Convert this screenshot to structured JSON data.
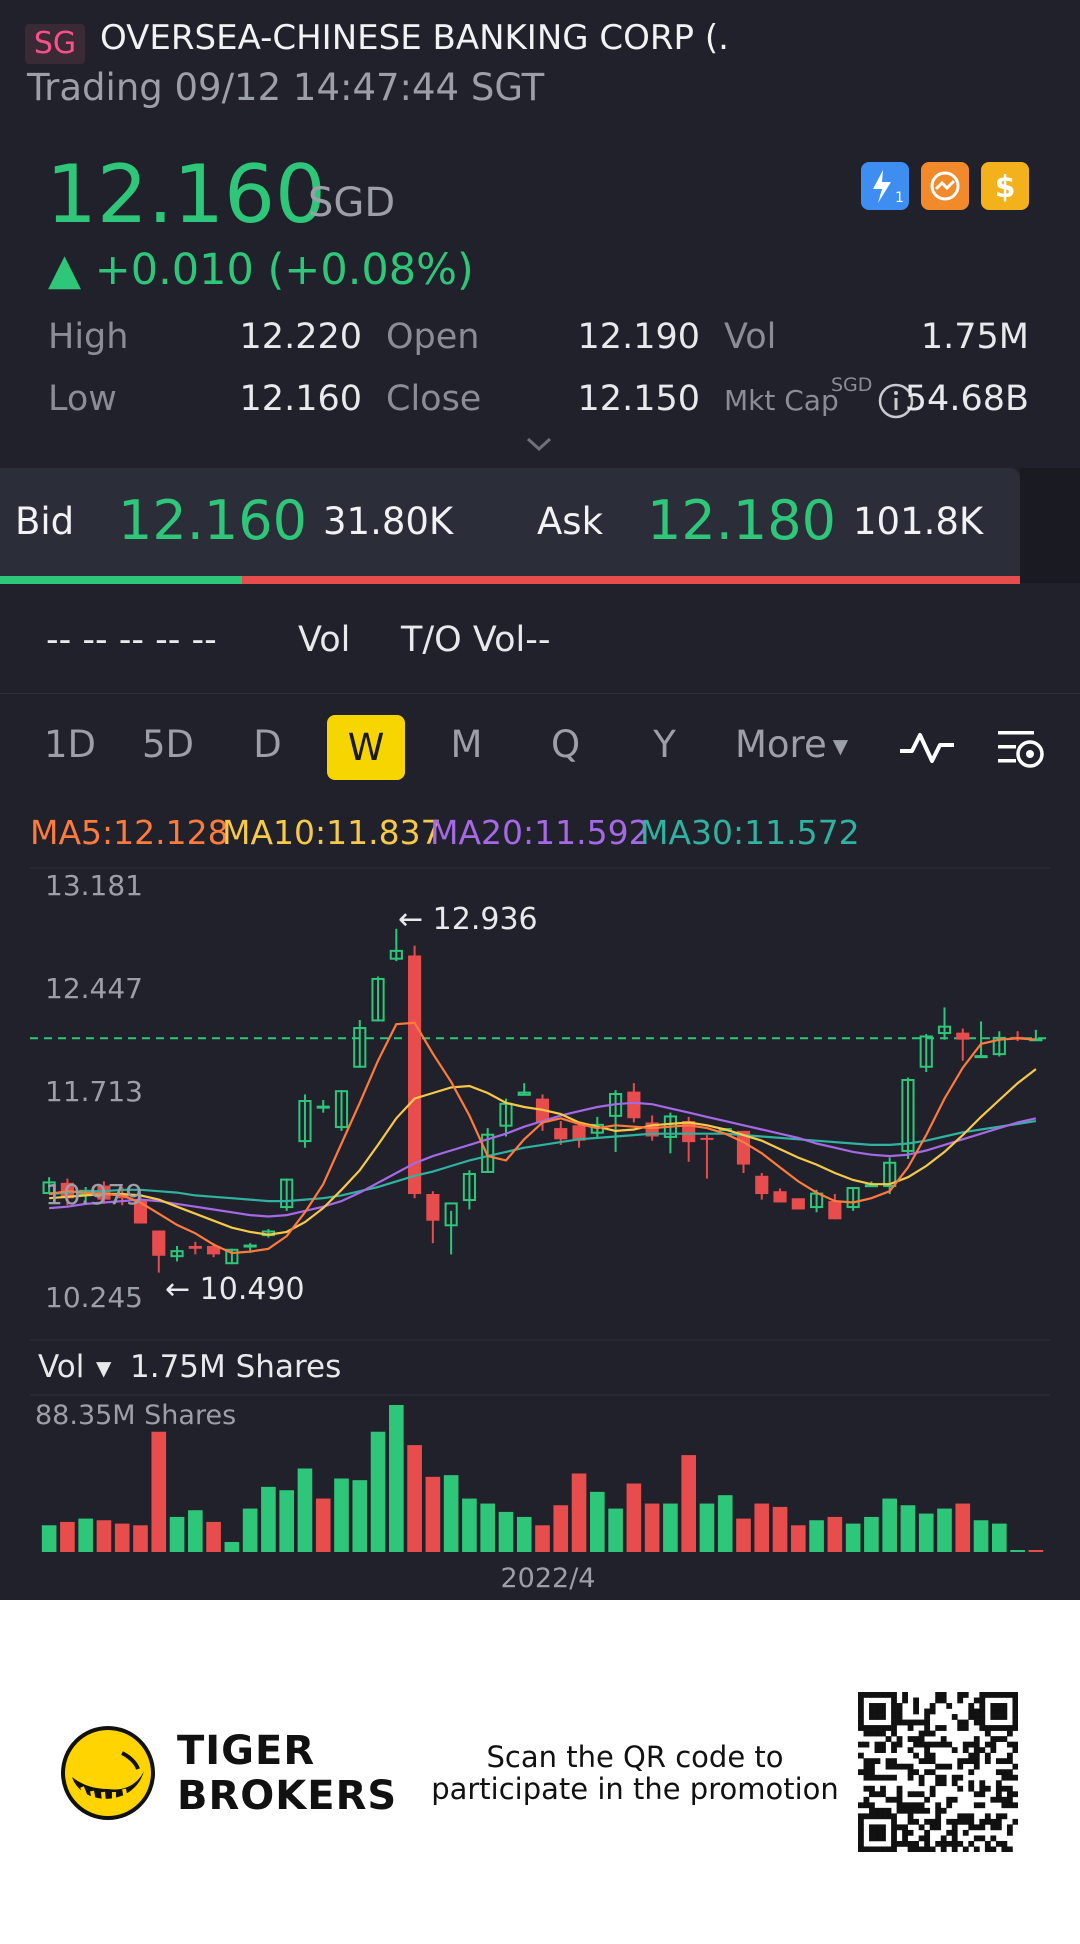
{
  "header": {
    "badge": "SG",
    "title": "OVERSEA-CHINESE BANKING CORP (.",
    "subtitle": "Trading 09/12 14:47:44 SGT"
  },
  "quote": {
    "price": "12.160",
    "currency": "SGD",
    "change": "▲ +0.010 (+0.08%)",
    "stats": {
      "high_label": "High",
      "high": "12.220",
      "open_label": "Open",
      "open": "12.190",
      "vol_label": "Vol",
      "vol": "1.75M",
      "low_label": "Low",
      "low": "12.160",
      "close_label": "Close",
      "close": "12.150",
      "mktcap_label": "Mkt Cap",
      "mktcap_sup": "SGD",
      "mktcap": "54.68B"
    },
    "icons": [
      "lightning-level1-icon",
      "transfer-icon",
      "dollar-icon"
    ]
  },
  "bidask": {
    "bid_label": "Bid",
    "bid_price": "12.160",
    "bid_size": "31.80K",
    "ask_label": "Ask",
    "ask_price": "12.180",
    "ask_size": "101.8K",
    "bid_ratio": 0.237
  },
  "turnover": {
    "dashes": "-- -- -- -- --",
    "vol_label": "Vol",
    "to_vol": "T/O Vol--"
  },
  "tabs": {
    "items": [
      "1D",
      "5D",
      "D",
      "W",
      "M",
      "Q",
      "Y"
    ],
    "active": "W",
    "more": "More"
  },
  "ma": {
    "ma5": "MA5:12.128",
    "ma10": "MA10:11.837",
    "ma20": "MA20:11.592",
    "ma30": "MA30:11.572"
  },
  "colors": {
    "up": "#2ec77a",
    "down": "#e84d4d",
    "ma5": "#ff7a3d",
    "ma10": "#f7c948",
    "ma20": "#a569e6",
    "ma30": "#2fb3a0",
    "accent": "#f7d500"
  },
  "chart_data": {
    "type": "candlestick",
    "y_ticks": [
      "13.181",
      "12.447",
      "11.713",
      "10.979",
      "10.245"
    ],
    "ylim": [
      10.245,
      13.181
    ],
    "high_annotation": "← 12.936",
    "low_annotation": "← 10.490",
    "last_price_line": 12.16,
    "ohlc": [
      [
        11.05,
        11.17,
        11.05,
        11.14
      ],
      [
        11.13,
        11.16,
        10.97,
        11.02
      ],
      [
        11.04,
        11.1,
        10.99,
        11.08
      ],
      [
        11.11,
        11.14,
        10.98,
        11.01
      ],
      [
        11.05,
        11.1,
        10.97,
        11.02
      ],
      [
        11.0,
        11.03,
        10.84,
        10.84
      ],
      [
        10.79,
        10.79,
        10.49,
        10.61
      ],
      [
        10.6,
        10.68,
        10.57,
        10.65
      ],
      [
        10.68,
        10.71,
        10.62,
        10.66
      ],
      [
        10.68,
        10.7,
        10.6,
        10.62
      ],
      [
        10.55,
        10.66,
        10.55,
        10.66
      ],
      [
        10.67,
        10.7,
        10.63,
        10.69
      ],
      [
        10.75,
        10.8,
        10.74,
        10.79
      ],
      [
        10.95,
        11.16,
        10.93,
        11.16
      ],
      [
        11.42,
        11.76,
        11.38,
        11.72
      ],
      [
        11.68,
        11.72,
        11.63,
        11.68
      ],
      [
        11.52,
        11.79,
        11.5,
        11.79
      ],
      [
        11.95,
        12.29,
        11.95,
        12.24
      ],
      [
        12.28,
        12.6,
        12.28,
        12.59
      ],
      [
        12.72,
        12.94,
        12.71,
        12.79
      ],
      [
        12.75,
        12.82,
        11.02,
        11.05
      ],
      [
        11.05,
        11.07,
        10.7,
        10.86
      ],
      [
        10.82,
        10.93,
        10.62,
        10.99
      ],
      [
        11.0,
        11.22,
        10.94,
        11.2
      ],
      [
        11.2,
        11.52,
        11.2,
        11.48
      ],
      [
        11.53,
        11.73,
        11.46,
        11.7
      ],
      [
        11.75,
        11.84,
        11.76,
        11.78
      ],
      [
        11.73,
        11.76,
        11.5,
        11.56
      ],
      [
        11.52,
        11.57,
        11.4,
        11.44
      ],
      [
        11.54,
        11.56,
        11.38,
        11.43
      ],
      [
        11.48,
        11.6,
        11.45,
        11.55
      ],
      [
        11.6,
        11.79,
        11.35,
        11.77
      ],
      [
        11.78,
        11.84,
        11.56,
        11.59
      ],
      [
        11.56,
        11.61,
        11.43,
        11.46
      ],
      [
        11.45,
        11.63,
        11.34,
        11.61
      ],
      [
        11.57,
        11.6,
        11.28,
        11.42
      ],
      [
        11.45,
        11.47,
        11.16,
        11.44
      ],
      [
        11.5,
        11.52,
        11.52,
        11.52
      ],
      [
        11.5,
        11.5,
        11.2,
        11.26
      ],
      [
        11.18,
        11.2,
        11.01,
        11.05
      ],
      [
        11.07,
        11.09,
        10.99,
        10.99
      ],
      [
        11.02,
        11.02,
        10.94,
        10.94
      ],
      [
        10.95,
        11.08,
        10.92,
        11.06
      ],
      [
        11.0,
        11.05,
        10.87,
        10.87
      ],
      [
        10.95,
        11.1,
        10.93,
        11.1
      ],
      [
        11.1,
        11.14,
        11.1,
        11.12
      ],
      [
        11.1,
        11.31,
        11.05,
        11.28
      ],
      [
        11.35,
        11.88,
        11.3,
        11.87
      ],
      [
        11.95,
        12.19,
        11.92,
        12.18
      ],
      [
        12.19,
        12.38,
        12.15,
        12.25
      ],
      [
        12.2,
        12.23,
        12.0,
        12.15
      ],
      [
        12.03,
        12.28,
        12.02,
        12.04
      ],
      [
        12.04,
        12.21,
        12.03,
        12.17
      ],
      [
        12.17,
        12.21,
        12.14,
        12.16
      ],
      [
        12.16,
        12.22,
        12.15,
        12.16
      ]
    ],
    "ma5": [
      11.05,
      11.07,
      11.06,
      11.05,
      11.04,
      10.99,
      10.91,
      10.83,
      10.77,
      10.69,
      10.63,
      10.64,
      10.66,
      10.75,
      10.92,
      11.12,
      11.41,
      11.7,
      12.0,
      12.26,
      12.27,
      12.05,
      11.85,
      11.61,
      11.32,
      11.29,
      11.44,
      11.56,
      11.59,
      11.55,
      11.52,
      11.54,
      11.53,
      11.52,
      11.53,
      11.54,
      11.52,
      11.48,
      11.42,
      11.34,
      11.24,
      11.14,
      11.06,
      11.0,
      10.99,
      11.02,
      11.07,
      11.24,
      11.47,
      11.73,
      11.95,
      12.12,
      12.15,
      12.16,
      12.15
    ],
    "ma10": [
      11.02,
      11.03,
      11.04,
      11.05,
      11.05,
      11.04,
      11.01,
      10.96,
      10.91,
      10.86,
      10.81,
      10.78,
      10.76,
      10.78,
      10.85,
      10.95,
      11.08,
      11.22,
      11.4,
      11.59,
      11.73,
      11.77,
      11.81,
      11.82,
      11.77,
      11.7,
      11.67,
      11.65,
      11.62,
      11.56,
      11.53,
      11.5,
      11.51,
      11.54,
      11.55,
      11.56,
      11.54,
      11.51,
      11.47,
      11.43,
      11.37,
      11.31,
      11.26,
      11.2,
      11.15,
      11.12,
      11.12,
      11.17,
      11.25,
      11.35,
      11.47,
      11.6,
      11.72,
      11.84,
      11.94
    ],
    "ma20": [
      10.95,
      10.96,
      10.98,
      10.99,
      11.0,
      11.01,
      11.0,
      10.98,
      10.96,
      10.94,
      10.92,
      10.9,
      10.89,
      10.9,
      10.93,
      10.96,
      11.0,
      11.06,
      11.13,
      11.2,
      11.27,
      11.32,
      11.36,
      11.4,
      11.44,
      11.48,
      11.53,
      11.57,
      11.61,
      11.64,
      11.67,
      11.69,
      11.7,
      11.69,
      11.66,
      11.63,
      11.6,
      11.57,
      11.54,
      11.51,
      11.48,
      11.45,
      11.41,
      11.38,
      11.35,
      11.33,
      11.32,
      11.33,
      11.36,
      11.4,
      11.44,
      11.48,
      11.52,
      11.56,
      11.59
    ],
    "ma30": [
      11.05,
      11.06,
      11.07,
      11.07,
      11.08,
      11.08,
      11.07,
      11.06,
      11.04,
      11.03,
      11.02,
      11.01,
      11.0,
      11.0,
      11.01,
      11.02,
      11.04,
      11.07,
      11.1,
      11.14,
      11.18,
      11.21,
      11.25,
      11.29,
      11.32,
      11.35,
      11.38,
      11.4,
      11.42,
      11.44,
      11.45,
      11.46,
      11.47,
      11.48,
      11.48,
      11.48,
      11.48,
      11.48,
      11.47,
      11.46,
      11.45,
      11.44,
      11.43,
      11.42,
      11.41,
      11.4,
      11.4,
      11.41,
      11.43,
      11.46,
      11.49,
      11.51,
      11.53,
      11.55,
      11.57
    ],
    "volume": {
      "label": "Vol",
      "current": "1.75M Shares",
      "max_label": "88.35M Shares",
      "x_label": "2022/4",
      "values": [
        16,
        18,
        20,
        19,
        17,
        16,
        72,
        21,
        25,
        18,
        6,
        26,
        39,
        37,
        50,
        32,
        44,
        43,
        72,
        88,
        64,
        45,
        46,
        32,
        29,
        24,
        21,
        16,
        28,
        47,
        36,
        26,
        41,
        29,
        29,
        58,
        29,
        34,
        20,
        29,
        27,
        16,
        19,
        21,
        17,
        21,
        32,
        28,
        23,
        26,
        29,
        19,
        17,
        1,
        1
      ],
      "up": [
        1,
        0,
        1,
        0,
        0,
        0,
        0,
        1,
        1,
        0,
        1,
        1,
        1,
        1,
        1,
        0,
        1,
        1,
        1,
        1,
        0,
        0,
        1,
        1,
        1,
        1,
        1,
        0,
        0,
        0,
        1,
        1,
        0,
        0,
        1,
        0,
        1,
        1,
        0,
        0,
        0,
        0,
        1,
        0,
        1,
        1,
        1,
        1,
        1,
        1,
        0,
        1,
        1,
        1,
        0
      ]
    }
  },
  "footer": {
    "brand_line1": "TIGER",
    "brand_line2": "BROKERS",
    "promo_line1": "Scan the QR code to",
    "promo_line2": "participate in the promotion"
  }
}
